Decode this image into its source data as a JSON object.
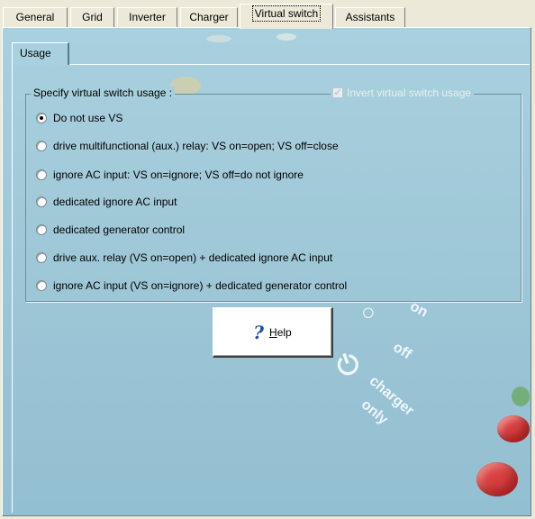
{
  "tabs": [
    "General",
    "Grid",
    "Inverter",
    "Charger",
    "Virtual switch",
    "Assistants"
  ],
  "active_tab": "Virtual switch",
  "inner_tab": "Usage",
  "group": {
    "title": "Specify virtual switch usage :",
    "invert_label": "Invert virtual switch usage",
    "invert_checked": true
  },
  "options": [
    "Do not use VS",
    "drive multifunctional (aux.) relay: VS on=open; VS off=close",
    "ignore AC input: VS on=ignore;  VS off=do not ignore",
    "dedicated ignore AC input",
    "dedicated generator control",
    "drive aux. relay (VS on=open) + dedicated ignore AC input",
    "ignore AC input (VS on=ignore) + dedicated generator control"
  ],
  "selected_option": 0,
  "help": {
    "label_rest": "elp",
    "label_mnemonic": "H"
  },
  "background_text": {
    "on": "on",
    "off": "off",
    "charger": "charger",
    "only": "only"
  },
  "colors": {
    "panel": "#a9d0de",
    "help_icon": "#1f4fa8",
    "led_red": "#d84040",
    "led_green": "#5aa040"
  }
}
